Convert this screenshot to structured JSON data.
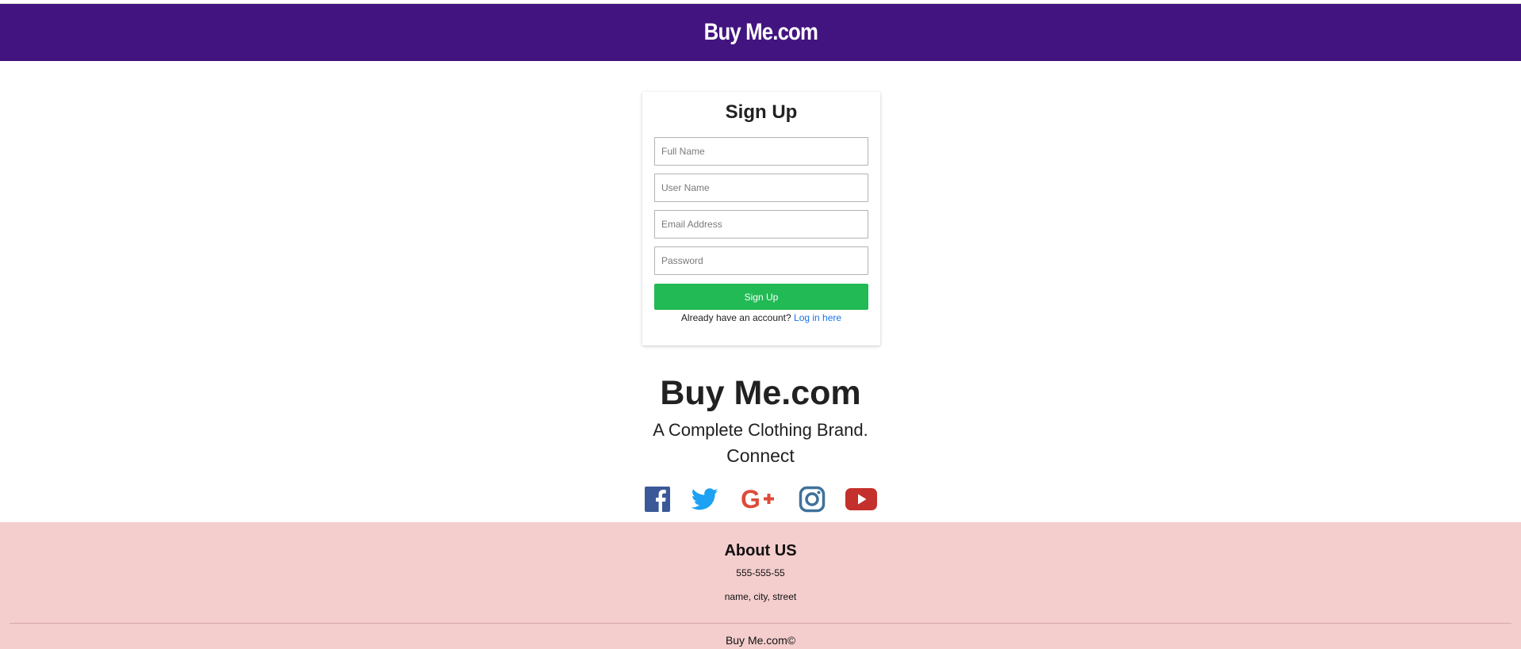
{
  "header": {
    "brand": "Buy Me.com",
    "brand_color": "#42147f"
  },
  "signup": {
    "title": "Sign Up",
    "full_name_placeholder": "Full Name",
    "user_name_placeholder": "User Name",
    "email_placeholder": "Email Address",
    "password_placeholder": "Password",
    "button_label": "Sign Up",
    "button_color": "#21ba54",
    "login_prompt": "Already have an account?",
    "login_link": "Log in here"
  },
  "promo": {
    "title": "Buy Me.com",
    "subtitle": "A Complete Clothing Brand.",
    "connect": "Connect"
  },
  "social": [
    {
      "icon": "facebook-icon",
      "color": "#3b5998"
    },
    {
      "icon": "twitter-icon",
      "color": "#1da1f2"
    },
    {
      "icon": "google-plus-icon",
      "color": "#dd4b39"
    },
    {
      "icon": "instagram-icon",
      "color": "#3f729b"
    },
    {
      "icon": "youtube-icon",
      "color": "#c4302b"
    }
  ],
  "footer": {
    "title": "About US",
    "phone": "555-555-55",
    "address": "name, city, street",
    "copyright": "Buy Me.com©",
    "background": "#f4cdcd"
  }
}
